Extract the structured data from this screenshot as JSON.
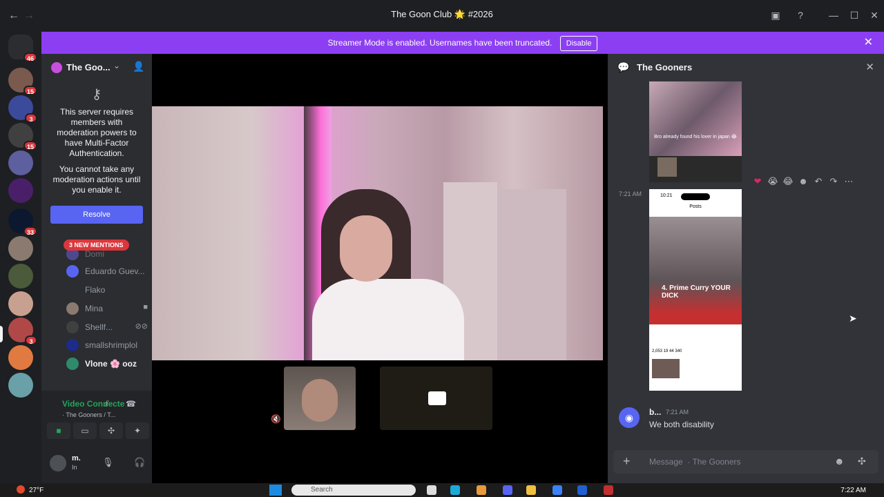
{
  "window": {
    "title": "The Goon Club 🌟 #2026",
    "back_icon": "arrow-left-icon",
    "forward_icon": "arrow-right-icon"
  },
  "banner": {
    "text": "Streamer Mode is enabled. Usernames have been truncated.",
    "button": "Disable"
  },
  "guilds": [
    {
      "badge": "46"
    },
    {
      "badge": "15"
    },
    {
      "badge": "3"
    },
    {
      "badge": "15"
    },
    {
      "badge": ""
    },
    {
      "badge": ""
    },
    {
      "badge": "33"
    },
    {
      "badge": ""
    },
    {
      "badge": ""
    },
    {
      "badge": ""
    },
    {
      "badge": "3"
    },
    {
      "badge": ""
    },
    {
      "badge": ""
    }
  ],
  "server": {
    "name": "The Goo..."
  },
  "mfa_notice": {
    "line1": "This server requires members with moderation powers to have Multi-Factor Authentication.",
    "line2": "You cannot take any moderation actions until you enable it.",
    "button": "Resolve"
  },
  "mentions_pill": "3 NEW MENTIONS",
  "members": [
    {
      "name": "Domi"
    },
    {
      "name": "Eduardo Guev..."
    },
    {
      "name": "Flako"
    },
    {
      "name": "Mina"
    },
    {
      "name": "Shellf..."
    },
    {
      "name": "smallshrimplol"
    },
    {
      "name": "Vlone 🌸 ooz"
    }
  ],
  "voice": {
    "status": "Video Connecte",
    "channel": "· The Gooners / T..."
  },
  "user": {
    "name": "m.",
    "status": "In"
  },
  "chat": {
    "title": "The Gooners",
    "media1_caption": "Bro already found his lover in japan 😂",
    "reactions": [
      "❤",
      "😭",
      "😂",
      "☻",
      "↶",
      "↷",
      "⋯"
    ],
    "msg_time": "7:21 AM",
    "media2": {
      "clock": "10:21",
      "posts_label": "Posts",
      "overlay": "4. Prime Curry YOUR DICK",
      "stats": "2,053  19  44  340"
    },
    "last_message": {
      "author": "b...",
      "time": "7:21 AM",
      "text": "We both disability"
    },
    "composer_placeholder": "Message  · The Gooners"
  },
  "taskbar": {
    "weather": "27°F",
    "search": "Search",
    "time": "7:22 AM"
  },
  "colors": {
    "banner": "#8c3ff2",
    "accent": "#5865f2",
    "mention_red": "#da373c",
    "online_green": "#23a55a"
  }
}
